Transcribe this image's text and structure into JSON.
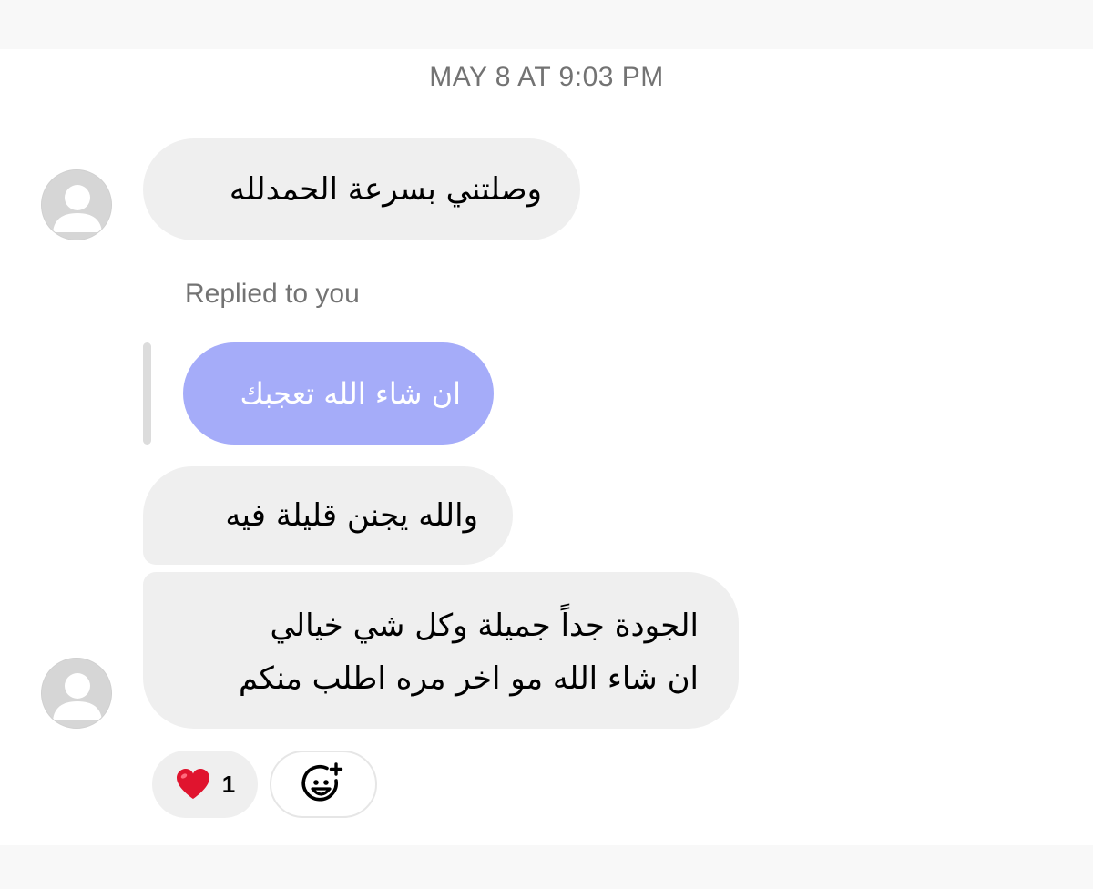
{
  "timestamp": "MAY 8 AT 9:03 PM",
  "messages": [
    {
      "text": "وصلتني بسرعة الحمدلله"
    },
    {
      "text": "والله يجنن قليلة فيه"
    },
    {
      "lines": [
        "الجودة جداً جميلة وكل شي خيالي",
        "ان شاء الله مو اخر مره اطلب منكم"
      ]
    }
  ],
  "reply": {
    "label": "Replied to you",
    "quoted_text": "ان شاء الله تعجبك",
    "quoted_bubble_color": "#a5acf9"
  },
  "reactions": {
    "emoji_icon": "red-heart-icon",
    "count": "1",
    "add_icon": "add-reaction-smiley-icon"
  },
  "colors": {
    "incoming_bubble": "#efefef",
    "meta_text": "#737373",
    "heart": "#e0142e"
  }
}
